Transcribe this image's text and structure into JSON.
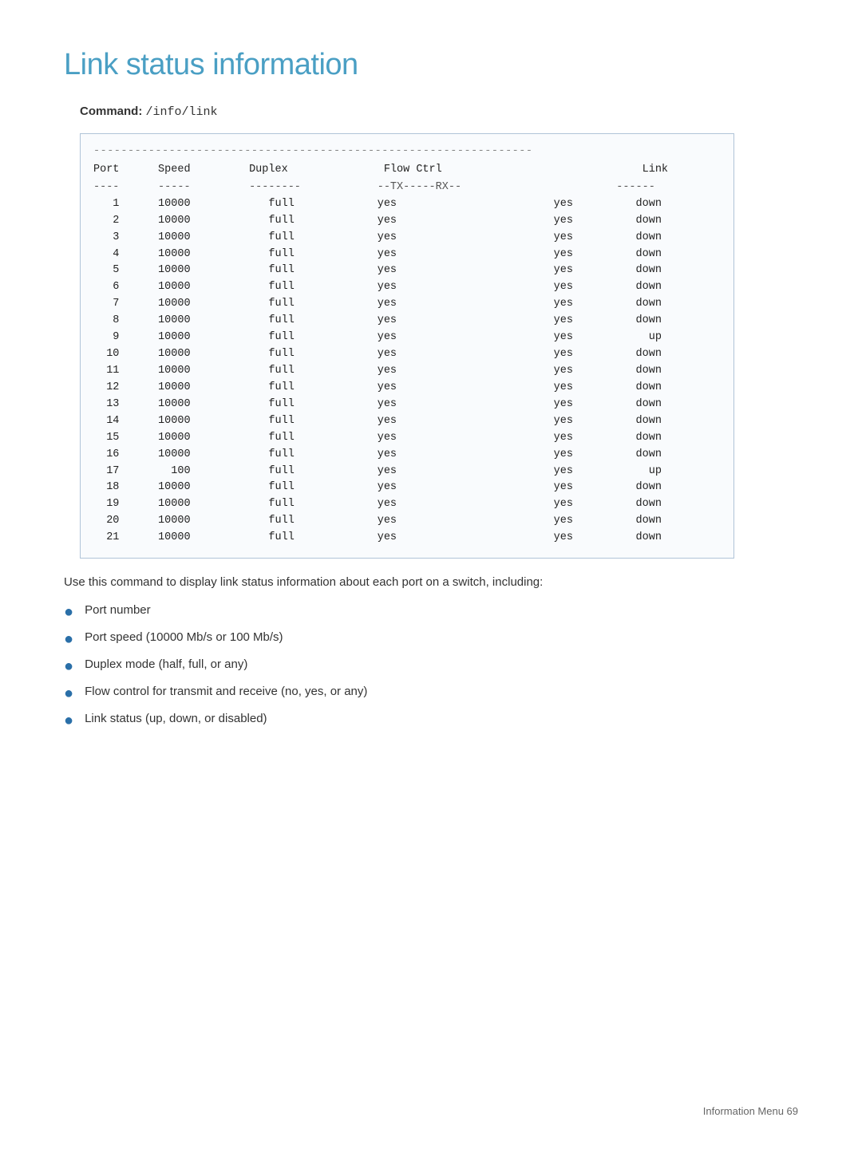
{
  "page": {
    "title": "Link status information",
    "command_label": "Command:",
    "command_value": "/info/link",
    "terminal": {
      "top_line": "----------------------------------------------------------------",
      "header": "Port   Speed    Duplex     Flow Ctrl      Link",
      "sep": "----   -----    --------   --TX-----RX--  ------",
      "rows": [
        {
          "port": "1",
          "speed": "10000",
          "duplex": "full",
          "tx": "yes",
          "rx": "yes",
          "link": "down"
        },
        {
          "port": "2",
          "speed": "10000",
          "duplex": "full",
          "tx": "yes",
          "rx": "yes",
          "link": "down"
        },
        {
          "port": "3",
          "speed": "10000",
          "duplex": "full",
          "tx": "yes",
          "rx": "yes",
          "link": "down"
        },
        {
          "port": "4",
          "speed": "10000",
          "duplex": "full",
          "tx": "yes",
          "rx": "yes",
          "link": "down"
        },
        {
          "port": "5",
          "speed": "10000",
          "duplex": "full",
          "tx": "yes",
          "rx": "yes",
          "link": "down"
        },
        {
          "port": "6",
          "speed": "10000",
          "duplex": "full",
          "tx": "yes",
          "rx": "yes",
          "link": "down"
        },
        {
          "port": "7",
          "speed": "10000",
          "duplex": "full",
          "tx": "yes",
          "rx": "yes",
          "link": "down"
        },
        {
          "port": "8",
          "speed": "10000",
          "duplex": "full",
          "tx": "yes",
          "rx": "yes",
          "link": "down"
        },
        {
          "port": "9",
          "speed": "10000",
          "duplex": "full",
          "tx": "yes",
          "rx": "yes",
          "link": "up"
        },
        {
          "port": "10",
          "speed": "10000",
          "duplex": "full",
          "tx": "yes",
          "rx": "yes",
          "link": "down"
        },
        {
          "port": "11",
          "speed": "10000",
          "duplex": "full",
          "tx": "yes",
          "rx": "yes",
          "link": "down"
        },
        {
          "port": "12",
          "speed": "10000",
          "duplex": "full",
          "tx": "yes",
          "rx": "yes",
          "link": "down"
        },
        {
          "port": "13",
          "speed": "10000",
          "duplex": "full",
          "tx": "yes",
          "rx": "yes",
          "link": "down"
        },
        {
          "port": "14",
          "speed": "10000",
          "duplex": "full",
          "tx": "yes",
          "rx": "yes",
          "link": "down"
        },
        {
          "port": "15",
          "speed": "10000",
          "duplex": "full",
          "tx": "yes",
          "rx": "yes",
          "link": "down"
        },
        {
          "port": "16",
          "speed": "10000",
          "duplex": "full",
          "tx": "yes",
          "rx": "yes",
          "link": "down"
        },
        {
          "port": "17",
          "speed": "100",
          "duplex": "full",
          "tx": "yes",
          "rx": "yes",
          "link": "up"
        },
        {
          "port": "18",
          "speed": "10000",
          "duplex": "full",
          "tx": "yes",
          "rx": "yes",
          "link": "down"
        },
        {
          "port": "19",
          "speed": "10000",
          "duplex": "full",
          "tx": "yes",
          "rx": "yes",
          "link": "down"
        },
        {
          "port": "20",
          "speed": "10000",
          "duplex": "full",
          "tx": "yes",
          "rx": "yes",
          "link": "down"
        },
        {
          "port": "21",
          "speed": "10000",
          "duplex": "full",
          "tx": "yes",
          "rx": "yes",
          "link": "down"
        }
      ]
    },
    "description": "Use this command to display link status information about each port on a switch, including:",
    "bullets": [
      "Port number",
      "Port speed (10000 Mb/s or 100 Mb/s)",
      "Duplex mode (half, full, or any)",
      "Flow control for transmit and receive (no, yes, or any)",
      "Link status (up, down, or disabled)"
    ],
    "footer": "Information Menu   69"
  }
}
